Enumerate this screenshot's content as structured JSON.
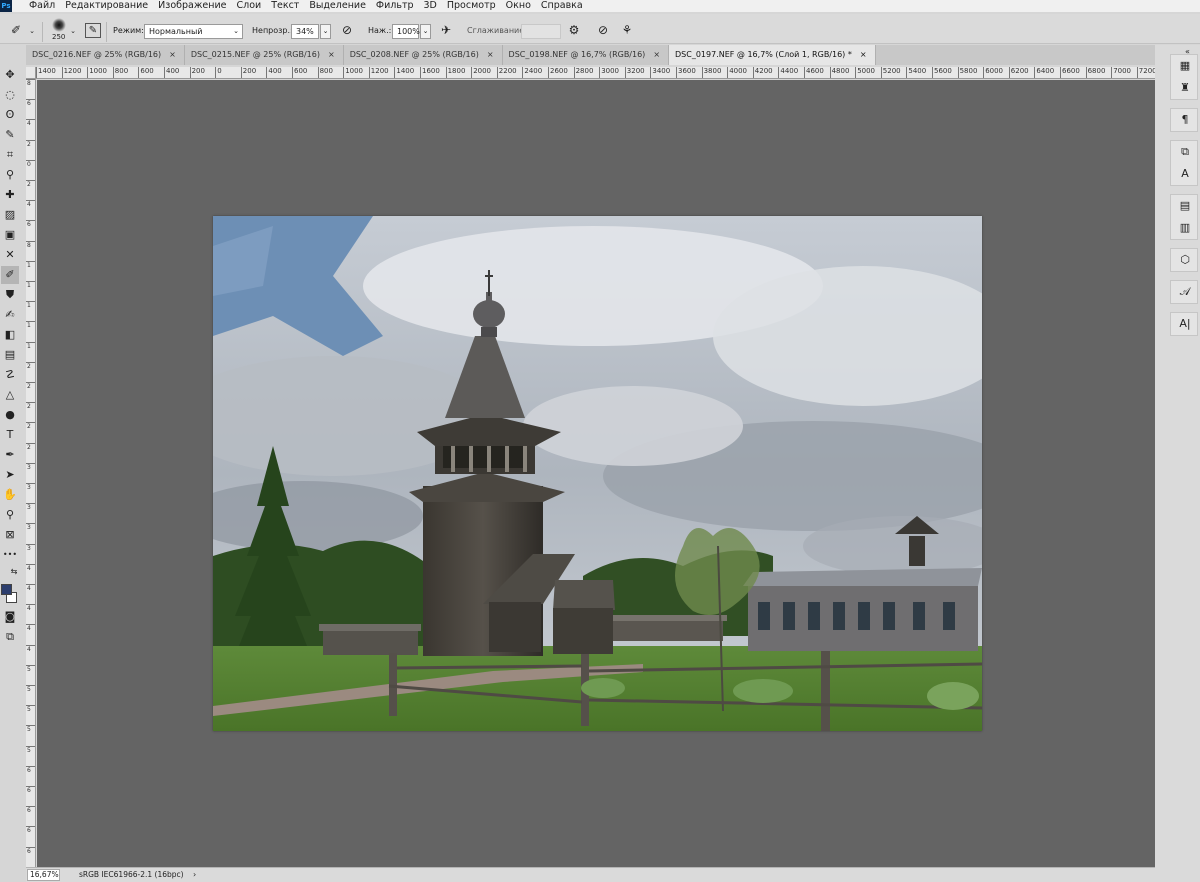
{
  "app": {
    "logo": "Ps"
  },
  "menu": [
    "Файл",
    "Редактирование",
    "Изображение",
    "Слои",
    "Текст",
    "Выделение",
    "Фильтр",
    "3D",
    "Просмотр",
    "Окно",
    "Справка"
  ],
  "options": {
    "brush_size": "250",
    "mode_label": "Режим:",
    "mode_value": "Нормальный",
    "opacity_label": "Непрозр.:",
    "opacity_value": "34%",
    "pressure_label": "Наж.:",
    "pressure_value": "100%",
    "smoothing_label": "Сглаживание:",
    "smoothing_value": ""
  },
  "tabs": [
    {
      "label": "DSC_0216.NEF @ 25% (RGB/16)",
      "close": "×"
    },
    {
      "label": "DSC_0215.NEF @ 25% (RGB/16)",
      "close": "×"
    },
    {
      "label": "DSC_0208.NEF @ 25% (RGB/16)",
      "close": "×"
    },
    {
      "label": "DSC_0198.NEF @ 16,7% (RGB/16)",
      "close": "×"
    },
    {
      "label": "DSC_0197.NEF @ 16,7% (Слой 1, RGB/16) *",
      "close": "×"
    }
  ],
  "active_tab": 4,
  "ruler_top": [
    "1400",
    "1200",
    "1000",
    "800",
    "600",
    "400",
    "200",
    "0",
    "200",
    "400",
    "600",
    "800",
    "1000",
    "1200",
    "1400",
    "1600",
    "1800",
    "2000",
    "2200",
    "2400",
    "2600",
    "2800",
    "3000",
    "3200",
    "3400",
    "3600",
    "3800",
    "4000",
    "4200",
    "4400",
    "4600",
    "4800",
    "5000",
    "5200",
    "5400",
    "5600",
    "5800",
    "6000",
    "6200",
    "6400",
    "6600",
    "6800",
    "7000",
    "7200"
  ],
  "ruler_left": [
    "8",
    "6",
    "4",
    "2",
    "0",
    "2",
    "4",
    "6",
    "8",
    "1",
    "1",
    "1",
    "1",
    "1",
    "2",
    "2",
    "2",
    "2",
    "2",
    "3",
    "3",
    "3",
    "3",
    "3",
    "4",
    "4",
    "4",
    "4",
    "4",
    "5",
    "5",
    "5",
    "5",
    "5",
    "6",
    "6",
    "6",
    "6",
    "6"
  ],
  "tools": [
    {
      "name": "move-tool",
      "glyph": "✥"
    },
    {
      "name": "marquee-tool",
      "glyph": "◌"
    },
    {
      "name": "lasso-tool",
      "glyph": "ʘ"
    },
    {
      "name": "quick-select-tool",
      "glyph": "✎"
    },
    {
      "name": "crop-tool",
      "glyph": "⌗"
    },
    {
      "name": "eyedropper-tool",
      "glyph": "⚲"
    },
    {
      "name": "healing-brush-tool",
      "glyph": "✚"
    },
    {
      "name": "patch-tool",
      "glyph": "▨"
    },
    {
      "name": "frame-tool",
      "glyph": "▣"
    },
    {
      "name": "puppet-warp-tool",
      "glyph": "✕"
    },
    {
      "name": "brush-tool",
      "glyph": "✐"
    },
    {
      "name": "clone-stamp-tool",
      "glyph": "⛊"
    },
    {
      "name": "history-brush-tool",
      "glyph": "✍"
    },
    {
      "name": "eraser-tool",
      "glyph": "◧"
    },
    {
      "name": "gradient-tool",
      "glyph": "▤"
    },
    {
      "name": "smudge-tool",
      "glyph": "☡"
    },
    {
      "name": "blur-tool",
      "glyph": "△"
    },
    {
      "name": "dodge-tool",
      "glyph": "●"
    },
    {
      "name": "text-tool",
      "glyph": "T"
    },
    {
      "name": "pen-tool",
      "glyph": "✒"
    },
    {
      "name": "path-select-tool",
      "glyph": "➤"
    },
    {
      "name": "hand-tool",
      "glyph": "✋"
    },
    {
      "name": "zoom-tool",
      "glyph": "⚲"
    },
    {
      "name": "frame-grid-tool",
      "glyph": "⊠"
    },
    {
      "name": "more-tools",
      "glyph": "•••"
    }
  ],
  "colors": {
    "foreground": "#2c3e6e",
    "background": "#ffffff",
    "canvas": "#646464"
  },
  "status": {
    "zoom": "16,67%",
    "profile": "sRGB IEC61966-2.1 (16bpc)",
    "arrow": "›"
  },
  "panel_icons": [
    {
      "name": "history-icon",
      "glyph": "▦"
    },
    {
      "name": "adjustments-icon",
      "glyph": "♜"
    },
    {
      "name": "paragraph-icon",
      "glyph": "¶"
    },
    {
      "name": "clone-source-icon",
      "glyph": "⧉"
    },
    {
      "name": "character-styles-icon",
      "glyph": "A"
    },
    {
      "name": "swatches-icon",
      "glyph": "▤"
    },
    {
      "name": "notes-icon",
      "glyph": "▥"
    },
    {
      "name": "3d-icon",
      "glyph": "⬡"
    },
    {
      "name": "glyphs-icon",
      "glyph": "𝒜"
    },
    {
      "name": "character-icon",
      "glyph": "A|"
    }
  ]
}
